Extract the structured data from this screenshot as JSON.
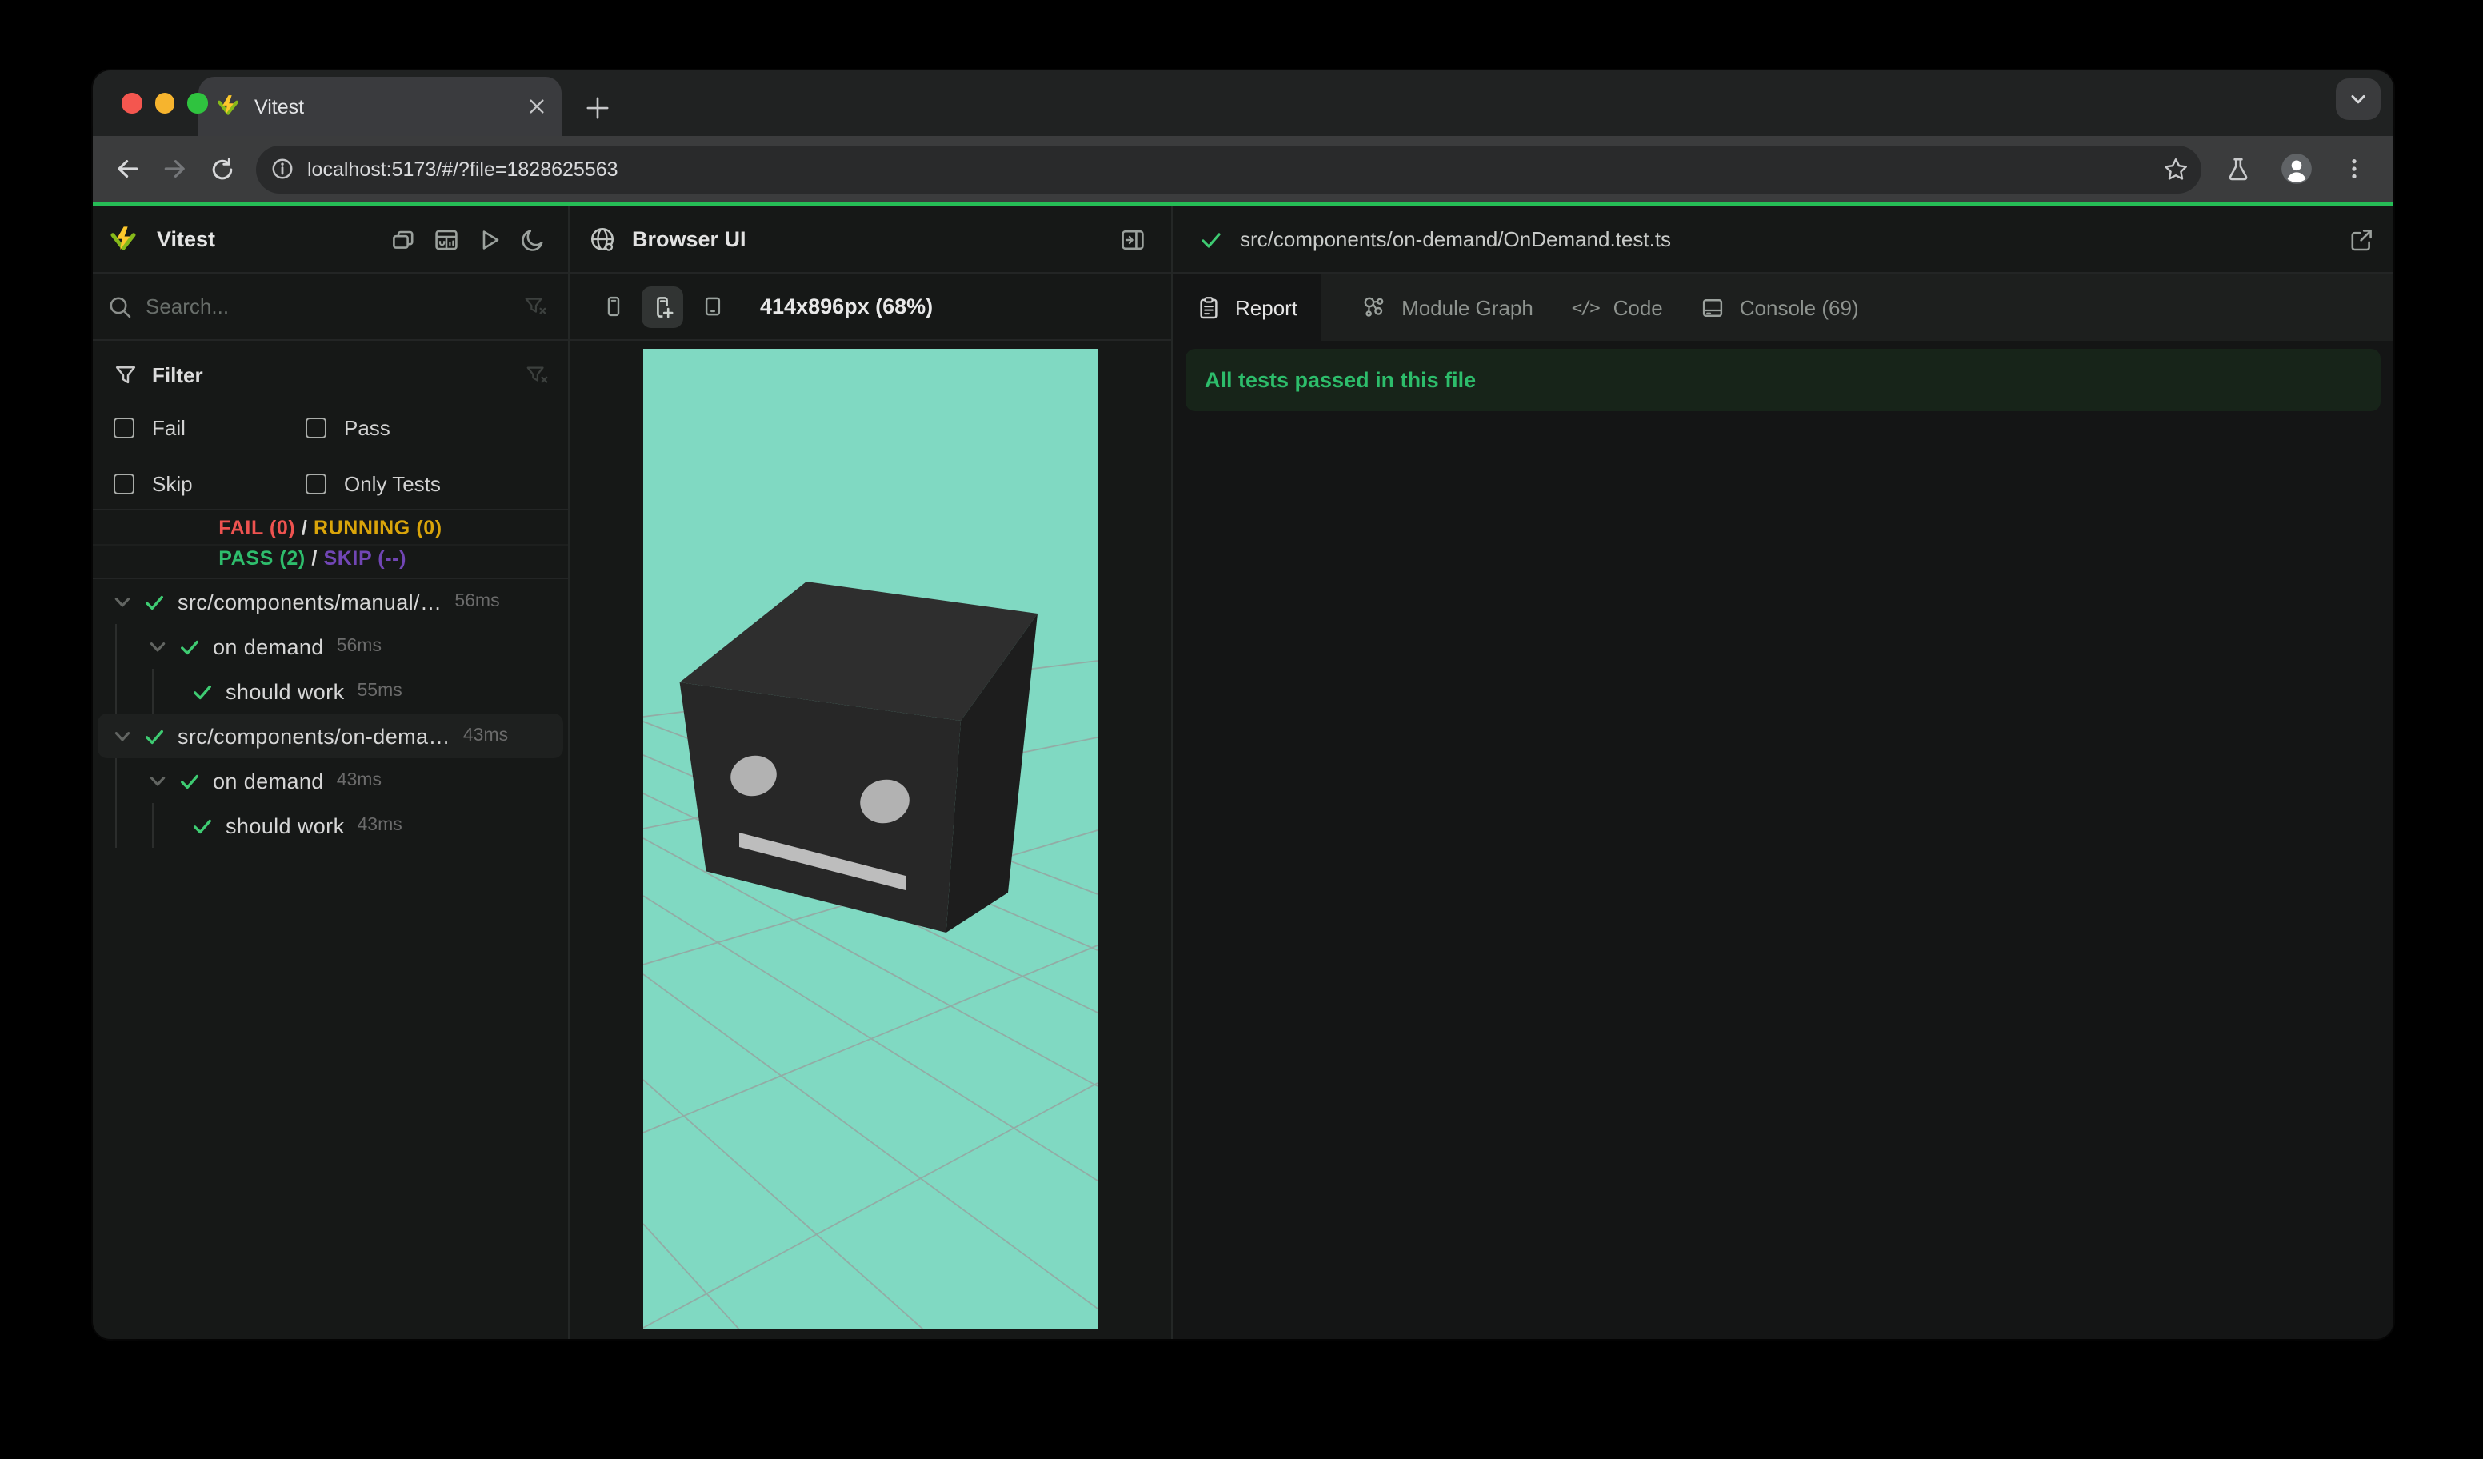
{
  "browser_chrome": {
    "tab": {
      "title": "Vitest"
    },
    "address_bar": {
      "url": "localhost:5173/#/?file=1828625563"
    },
    "traffic_light_colors": {
      "close": "#f4564f",
      "minimize": "#f6b42e",
      "zoom": "#2fc33f"
    },
    "progress_bar_color": "#26bc56"
  },
  "app": {
    "sidebar": {
      "title": "Vitest",
      "header_icons": [
        "windows-icon",
        "dashboard-icon",
        "run-all-icon",
        "dark-mode-icon"
      ],
      "search": {
        "placeholder": "Search..."
      },
      "filter": {
        "title": "Filter",
        "options": [
          "Fail",
          "Pass",
          "Skip",
          "Only Tests"
        ]
      },
      "summary": {
        "fail": "FAIL (0)",
        "running": "RUNNING (0)",
        "pass": "PASS (2)",
        "skip": "SKIP (--)",
        "separator": "/",
        "colors": {
          "fail": "#ee5350",
          "running": "#d9a40a",
          "pass": "#2ebd6c",
          "skip": "#7146b5"
        }
      },
      "tree": [
        {
          "type": "file",
          "label": "src/components/manual/…",
          "time": "56ms",
          "state": "pass"
        },
        {
          "type": "suite",
          "label": "on demand",
          "time": "56ms",
          "state": "pass"
        },
        {
          "type": "test",
          "label": "should work",
          "time": "55ms",
          "state": "pass"
        },
        {
          "type": "file",
          "label": "src/components/on-dema…",
          "time": "43ms",
          "state": "pass",
          "selected": true
        },
        {
          "type": "suite",
          "label": "on demand",
          "time": "43ms",
          "state": "pass"
        },
        {
          "type": "test",
          "label": "should work",
          "time": "43ms",
          "state": "pass"
        }
      ]
    },
    "browser_panel": {
      "title": "Browser UI",
      "device_buttons": [
        "phone-icon",
        "phone-plus-icon",
        "tablet-icon"
      ],
      "selected_device": 1,
      "viewport_label": "414x896px (68%)",
      "scene": {
        "background": "#80d9c2",
        "grid_line_color": "#9a9a9a",
        "cube_colors": {
          "top": "#2e2e2e",
          "front": "#272727",
          "right": "#1d1d1d"
        },
        "face_feature_color": "#b2b2b2"
      }
    },
    "report_panel": {
      "file_path": "src/components/on-demand/OnDemand.test.ts",
      "tabs": [
        {
          "label": "Report",
          "icon": "clipboard-icon",
          "active": true
        },
        {
          "label": "Module Graph",
          "icon": "module-graph-icon",
          "active": false
        },
        {
          "label": "Code",
          "icon": "code-icon",
          "code_glyph": "</>",
          "active": false
        },
        {
          "label": "Console (69)",
          "icon": "console-icon",
          "active": false
        }
      ],
      "banner": {
        "text": "All tests passed in this file",
        "bg": "#172419",
        "fg": "#2dbd6b"
      }
    }
  }
}
